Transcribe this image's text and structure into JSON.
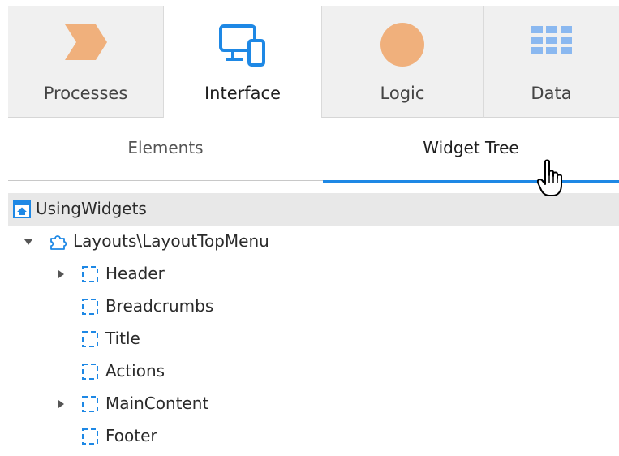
{
  "module_tabs": [
    {
      "label": "Processes",
      "icon": "process-chevron-icon",
      "active": false
    },
    {
      "label": "Interface",
      "icon": "monitor-mobile-icon",
      "active": true
    },
    {
      "label": "Logic",
      "icon": "logic-circle-icon",
      "active": false
    },
    {
      "label": "Data",
      "icon": "data-grid-icon",
      "active": false
    }
  ],
  "sub_tabs": [
    {
      "label": "Elements",
      "active": false
    },
    {
      "label": "Widget Tree",
      "active": true
    }
  ],
  "tree": {
    "root": {
      "label": "UsingWidgets",
      "icon": "screen-home-icon"
    },
    "items": [
      {
        "label": "Layouts\\LayoutTopMenu",
        "icon": "block-puzzle-icon",
        "expander": "expanded"
      },
      {
        "label": "Header",
        "icon": "placeholder-icon",
        "expander": "collapsed"
      },
      {
        "label": "Breadcrumbs",
        "icon": "placeholder-icon",
        "expander": "none"
      },
      {
        "label": "Title",
        "icon": "placeholder-icon",
        "expander": "none"
      },
      {
        "label": "Actions",
        "icon": "placeholder-icon",
        "expander": "none"
      },
      {
        "label": "MainContent",
        "icon": "placeholder-icon",
        "expander": "collapsed"
      },
      {
        "label": "Footer",
        "icon": "placeholder-icon",
        "expander": "none"
      }
    ]
  },
  "colors": {
    "accent_blue": "#1e88e5",
    "process_orange": "#f0b07c",
    "data_blue": "#8ab8f0"
  }
}
